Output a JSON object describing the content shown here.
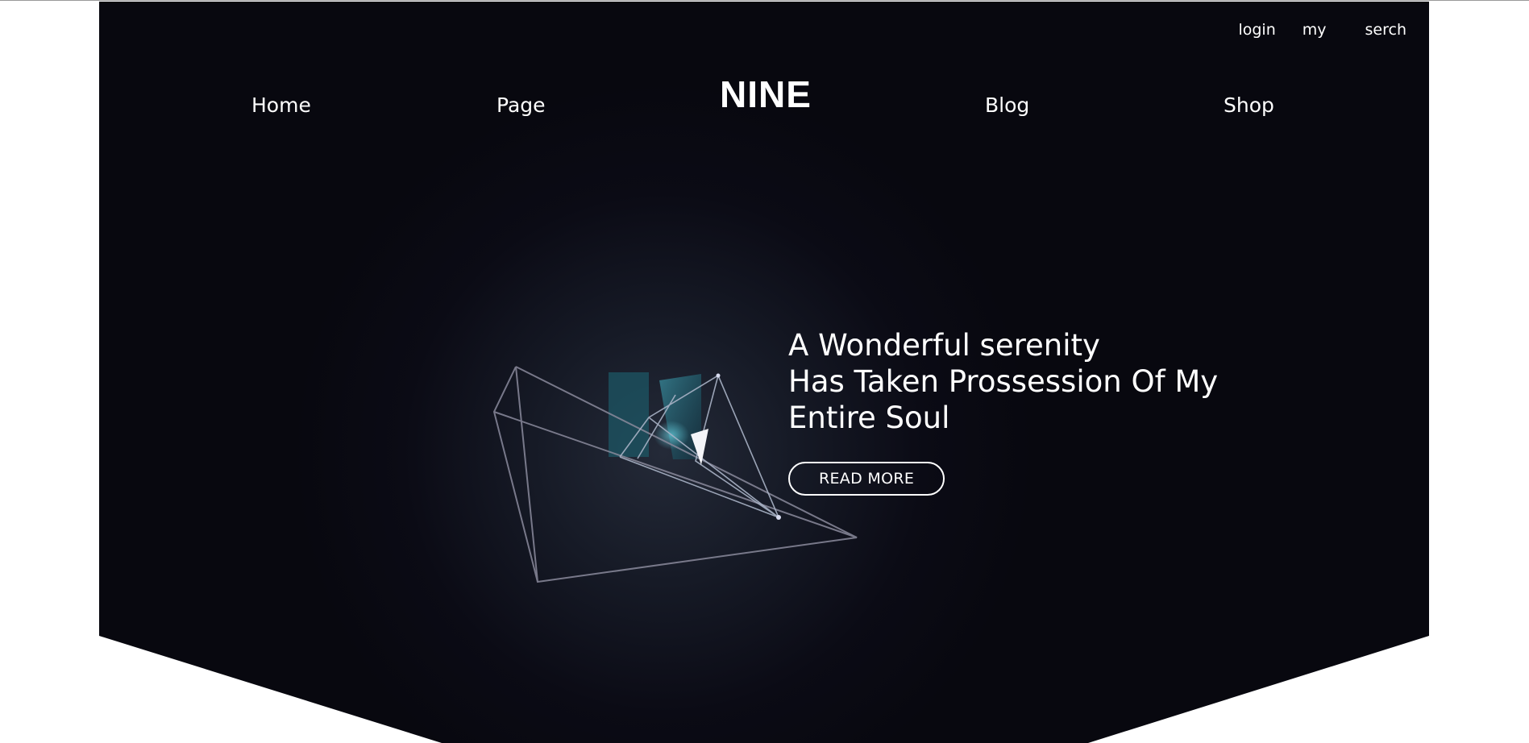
{
  "utility": {
    "login": "login",
    "my": "my",
    "search": "serch"
  },
  "nav": {
    "home": "Home",
    "page": "Page",
    "brand": "NINE",
    "blog": "Blog",
    "shop": "Shop"
  },
  "hero": {
    "headline_line1": "A Wonderful serenity",
    "headline_line2": "Has Taken Prossession Of My",
    "headline_line3": "Entire Soul",
    "cta": "READ MORE"
  },
  "colors": {
    "background": "#08080f",
    "text": "#ffffff",
    "accent": "#2ab0c0"
  }
}
